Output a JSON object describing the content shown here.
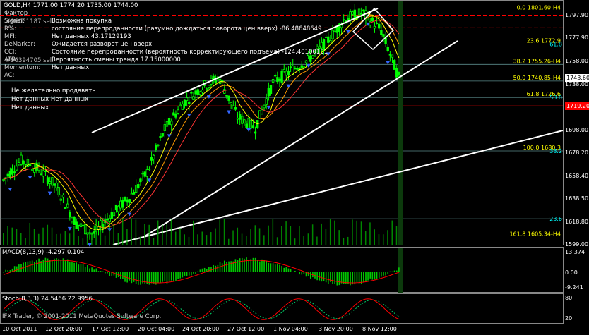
{
  "header": {
    "symbol_line": "GOLD,H4  1771.00 1774.20 1735.00 1744.00"
  },
  "indicator_panel": {
    "rows": [
      {
        "key": "Фактор",
        "ticket": "",
        "value": "",
        "color": "#ffffff"
      },
      {
        "key": "Signal:",
        "ticket": "#96051187 sell",
        "value": "Возможна покупка",
        "color": "#ffffff"
      },
      {
        "key": "R%:",
        "ticket": "",
        "value": "состояние перепроданности (разумно дождаться поворота цен вверх) -86.48648649",
        "color": "#ffffff"
      },
      {
        "key": "MFI:",
        "ticket": "",
        "value": "Нет данных 43.17129193",
        "color": "#ffffff"
      },
      {
        "key": "DeMarker:",
        "ticket": "",
        "value": "Ожидается разворот цен вверх",
        "color": "#ffffff"
      },
      {
        "key": "CCI:",
        "ticket": "",
        "value": "Состояние перепроданности (вероятность корректирующего подъема) -124.40100131",
        "color": "#ffffff"
      },
      {
        "key": "ATR:",
        "ticket": "#96394705 sell",
        "value": "Вероятность смены тренда 17.15000000",
        "color": "#ffffff"
      },
      {
        "key": "Momentum:",
        "ticket": "",
        "value": "Нет данных",
        "color": "#ffffff"
      },
      {
        "key": "AC:",
        "ticket": "",
        "value": "",
        "color": "#ffffff"
      }
    ],
    "extra_lines": [
      "Не желательно продавать",
      "Нет данных Нет данных",
      "Нет данных"
    ]
  },
  "fibo_levels": [
    {
      "label": "0.0 1801.60-H4",
      "price": 1801.6,
      "color": "#ffff00"
    },
    {
      "label": "23.6 1772.9",
      "price": 1772.9,
      "color": "#ffff00"
    },
    {
      "label": "38.2 1755.26-H4",
      "price": 1755.26,
      "color": "#ffff00"
    },
    {
      "label": "50.0 1740.85-H4",
      "price": 1740.85,
      "color": "#ffff00"
    },
    {
      "label": "61.8 1726.6",
      "price": 1726.6,
      "color": "#ffff00"
    },
    {
      "label": "100.0 1680.3",
      "price": 1680.3,
      "color": "#ffff00"
    },
    {
      "label": "161.8 1605.34-H4",
      "price": 1605.34,
      "color": "#ffff00"
    }
  ],
  "right_side_tags": [
    {
      "text": "61.8",
      "price": 1772.9
    },
    {
      "text": "50.0",
      "price": 1726.6
    },
    {
      "text": "38.2",
      "price": 1680.3
    },
    {
      "text": "23.6",
      "price": 1621.5
    }
  ],
  "price_axis": {
    "ticks": [
      "1797.90",
      "1777.90",
      "1758.00",
      "1738.00",
      "1718.00",
      "1698.00",
      "1678.20",
      "1658.40",
      "1638.50",
      "1618.80",
      "1599.00"
    ],
    "current_price": "1743.60",
    "red_level_price": "1719.20"
  },
  "macd": {
    "label": "MACD(8,13,9) -4.297 0.104",
    "ticks": [
      "13.374",
      "0.00",
      "-9.241"
    ]
  },
  "stoch": {
    "label": "Stoch(8,3,3) 24.5466 22.9956",
    "ticks": [
      "80",
      "20"
    ]
  },
  "time_axis": {
    "labels": [
      "10 Oct 2011",
      "12 Oct 20:00",
      "17 Oct 12:00",
      "20 Oct 04:00",
      "24 Oct 20:00",
      "27 Oct 12:00",
      "1 Nov 04:00",
      "3 Nov 20:00",
      "8 Nov 12:00"
    ]
  },
  "watermark": "IFX Trader, © 2001-2011 MetaQuotes Software Corp.",
  "chart_data": {
    "type": "line",
    "title": "GOLD,H4",
    "ylim": [
      1599,
      1808
    ],
    "x": [
      "10 Oct 2011",
      "12 Oct 20:00",
      "17 Oct 12:00",
      "20 Oct 04:00",
      "24 Oct 20:00",
      "27 Oct 12:00",
      "1 Nov 04:00",
      "3 Nov 20:00",
      "8 Nov 12:00"
    ],
    "series": [
      {
        "values": [
          1655,
          1672,
          1664,
          1648,
          1618,
          1608,
          1625,
          1640,
          1662,
          1700,
          1722,
          1735,
          1744,
          1710,
          1700,
          1740,
          1750,
          1760,
          1775,
          1795,
          1800,
          1785,
          1744
        ]
      }
    ],
    "colors": {
      "candle_up": "#00ff00",
      "candle_down": "#00ff00",
      "ma_fast": "#ffff00",
      "ma_slow": "#ff3333",
      "ma_mid": "#ff9900",
      "channel": "#ffffff",
      "macd_hist": "#00cc00",
      "macd_signal": "#ff0000",
      "stoch_main": "#ff0000",
      "stoch_signal": "#00cc66",
      "fractal": "#3366ff",
      "grid_red": "#ff0000"
    }
  }
}
